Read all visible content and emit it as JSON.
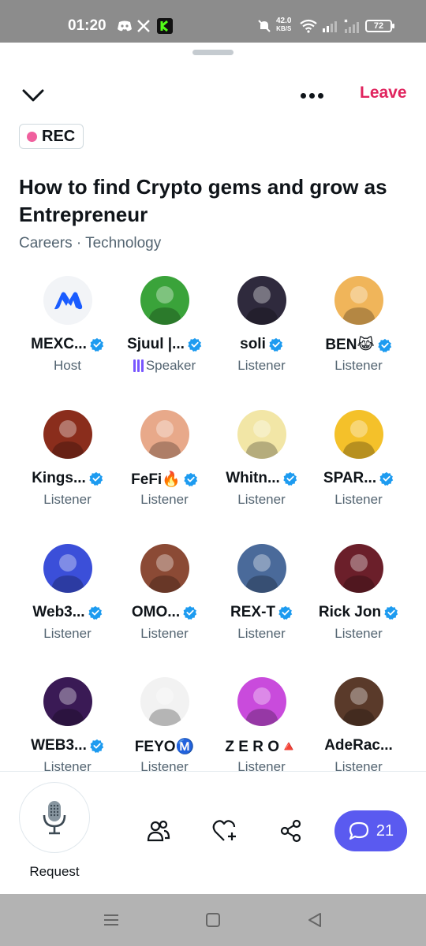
{
  "status_bar": {
    "time": "01:20",
    "net_speed_value": "42.0",
    "net_speed_unit": "KB/S",
    "battery": "72",
    "icons": [
      "discord-icon",
      "x-icon",
      "kick-icon",
      "mute-icon",
      "wifi-icon",
      "signal-icon",
      "signal-off-icon",
      "battery-icon"
    ]
  },
  "header": {
    "leave_label": "Leave",
    "rec_label": "REC"
  },
  "space": {
    "title": "How to find Crypto gems and grow as Entrepreneur",
    "topics": "Careers · Technology"
  },
  "participants": [
    {
      "name": "MEXC...",
      "role": "Host",
      "verified": true,
      "avatar": "mexc-logo",
      "color": "#f2f4f7"
    },
    {
      "name": "Sjuul |...",
      "role": "Speaker",
      "verified": true,
      "avatar": "man-green-background",
      "color": "#3aa33a"
    },
    {
      "name": "soli",
      "role": "Listener",
      "verified": true,
      "avatar": "woman-dark-art",
      "color": "#2f2a3d"
    },
    {
      "name": "BEN😹",
      "role": "Listener",
      "verified": true,
      "avatar": "orange-cat",
      "color": "#f0b55a"
    },
    {
      "name": "Kings...",
      "role": "Listener",
      "verified": true,
      "avatar": "bearded-warrior",
      "color": "#8a2d1c"
    },
    {
      "name": "FeFi🔥",
      "role": "Listener",
      "verified": true,
      "avatar": "cartoon-character",
      "color": "#e8a98a"
    },
    {
      "name": "Whitn...",
      "role": "Listener",
      "verified": true,
      "avatar": "sketch-woman",
      "color": "#f2e6a6"
    },
    {
      "name": "SPAR...",
      "role": "Listener",
      "verified": true,
      "avatar": "football-player",
      "color": "#f4c12a"
    },
    {
      "name": "Web3...",
      "role": "Listener",
      "verified": true,
      "avatar": "cartoon-man",
      "color": "#3b4fd9"
    },
    {
      "name": "OMO...",
      "role": "Listener",
      "verified": true,
      "avatar": "man-sunglasses",
      "color": "#8b4a35"
    },
    {
      "name": "REX-T",
      "role": "Listener",
      "verified": true,
      "avatar": "dinosaur-art",
      "color": "#4a6a9a"
    },
    {
      "name": "Rick Jon",
      "role": "Listener",
      "verified": true,
      "avatar": "bored-ape",
      "color": "#6b1f2a"
    },
    {
      "name": "WEB3...",
      "role": "Listener",
      "verified": true,
      "avatar": "cyberpunk-woman",
      "color": "#3a1a55"
    },
    {
      "name": "FEYOⓂ️",
      "role": "Listener",
      "verified": false,
      "avatar": "woman-braids",
      "color": "#f2f2f2"
    },
    {
      "name": "Z E R O🔺",
      "role": "Listener",
      "verified": false,
      "avatar": "purple-cartoon",
      "color": "#c94bdc"
    },
    {
      "name": "AdeRac...",
      "role": "Listener",
      "verified": false,
      "avatar": "funny-face",
      "color": "#5a3a2a"
    }
  ],
  "bottom_bar": {
    "request_label": "Request",
    "comment_count": "21",
    "comment_color": "#5a5af0"
  },
  "colors": {
    "leave": "#e0245e",
    "rec_dot": "#f0609e",
    "verified": "#1d9bf0",
    "speaker": "#7856ff"
  }
}
